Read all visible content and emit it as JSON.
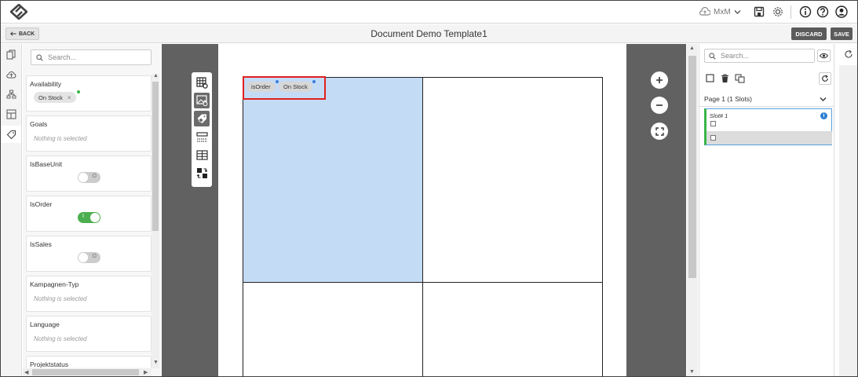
{
  "header": {
    "user_label": "MxM",
    "icons": [
      "logo-icon",
      "cloud-sync-icon",
      "chevron-down-icon",
      "save-disk-icon",
      "gear-icon",
      "info-icon",
      "help-icon",
      "user-icon"
    ]
  },
  "subbar": {
    "back_label": "BACK",
    "title": "Document Demo Template1",
    "discard_label": "DISCARD",
    "save_label": "SAVE"
  },
  "filters": {
    "search_placeholder": "Search...",
    "items": [
      {
        "label": "Availability",
        "type": "chips",
        "chips": [
          "On Stock"
        ]
      },
      {
        "label": "Goals",
        "type": "empty",
        "empty_text": "Nothing is selected"
      },
      {
        "label": "IsBaseUnit",
        "type": "toggle",
        "state": "off",
        "toggle_text": "O"
      },
      {
        "label": "IsOrder",
        "type": "toggle",
        "state": "on",
        "toggle_text": "I"
      },
      {
        "label": "IsSales",
        "type": "toggle",
        "state": "off",
        "toggle_text": "O"
      },
      {
        "label": "Kampagnen-Typ",
        "type": "empty",
        "empty_text": "Nothing is selected"
      },
      {
        "label": "Language",
        "type": "empty",
        "empty_text": "Nothing is selected"
      },
      {
        "label": "Projektstatus",
        "type": "partial"
      }
    ]
  },
  "canvas": {
    "selected_slot_chips": [
      "isOrder",
      "On Stock"
    ]
  },
  "right_panel": {
    "search_placeholder": "Search...",
    "page_label": "Page 1 (1 Slots)",
    "slot_name": "Slot# 1",
    "info_glyph": "i"
  },
  "colors": {
    "selected_slot": "#c4dbf6",
    "toggle_on": "#4cae4f",
    "highlight_box": "#e02020",
    "canvas_bg": "#616161"
  }
}
